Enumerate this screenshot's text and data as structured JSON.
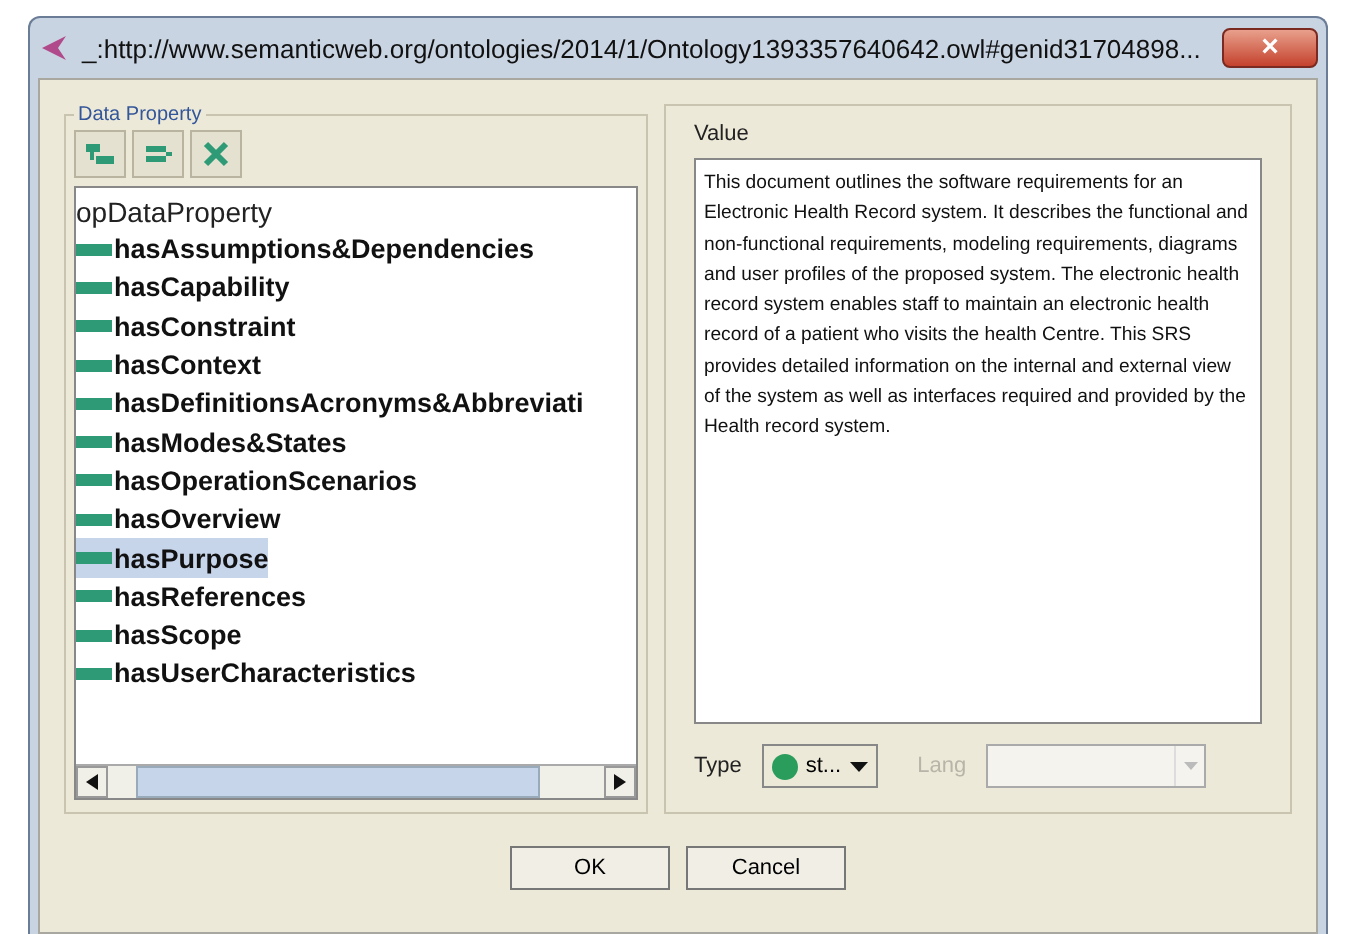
{
  "window": {
    "title": "_:http://www.semanticweb.org/ontologies/2014/1/Ontology1393357640642.owl#genid31704898...",
    "close": "×"
  },
  "data_property": {
    "legend": "Data Property",
    "tree": {
      "label": "opDataProperty",
      "selected": false,
      "children": [
        {
          "label": "hasAssumptions&Dependencies",
          "selected": false
        },
        {
          "label": "hasCapability",
          "selected": false
        },
        {
          "label": "hasConstraint",
          "selected": false
        },
        {
          "label": "hasContext",
          "selected": false
        },
        {
          "label": "hasDefinitionsAcronyms&Abbreviati",
          "selected": false
        },
        {
          "label": "hasModes&States",
          "selected": false
        },
        {
          "label": "hasOperationScenarios",
          "selected": false
        },
        {
          "label": "hasOverview",
          "selected": false
        },
        {
          "label": "hasPurpose",
          "selected": true
        },
        {
          "label": "hasReferences",
          "selected": false
        },
        {
          "label": "hasScope",
          "selected": false
        },
        {
          "label": "hasUserCharacteristics",
          "selected": false
        }
      ]
    }
  },
  "value": {
    "label": "Value",
    "text": "This document outlines the software requirements for an Electronic Health Record system. It describes the functional and non-functional requirements, modeling requirements, diagrams and user profiles of the proposed system. The electronic health record system enables staff to maintain an electronic health record of a patient who visits the health Centre. This SRS provides detailed information on the internal and external view of the system as well as interfaces required and provided by the Health record system."
  },
  "type": {
    "label": "Type",
    "value": "st..."
  },
  "lang": {
    "label": "Lang",
    "disabled": true
  },
  "buttons": [
    "OK",
    "Cancel"
  ]
}
